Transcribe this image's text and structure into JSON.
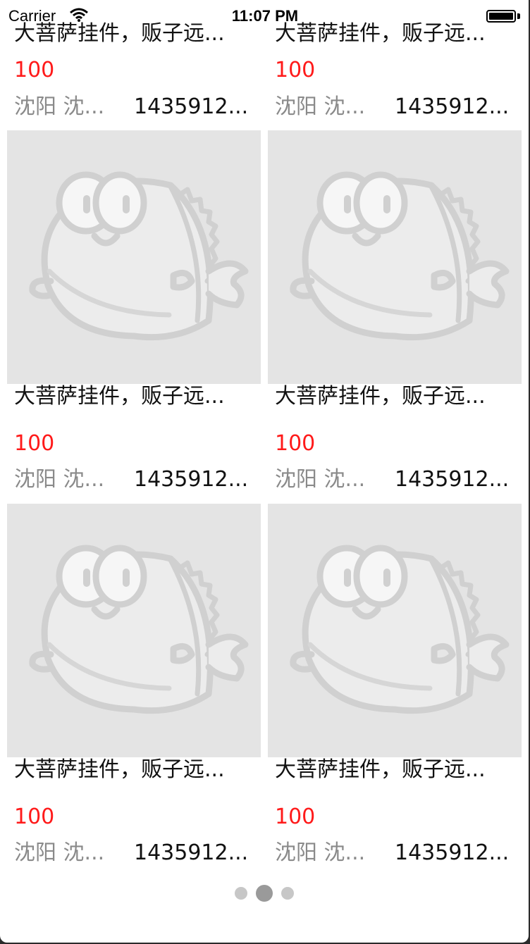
{
  "status_bar": {
    "carrier": "Carrier",
    "time": "11:07 PM"
  },
  "product": {
    "title": "大菩萨挂件，贩子远...",
    "price": "100",
    "location": "沈阳 沈...",
    "phone": "1435912..."
  },
  "pager": {
    "pages": 3,
    "current": 2
  }
}
